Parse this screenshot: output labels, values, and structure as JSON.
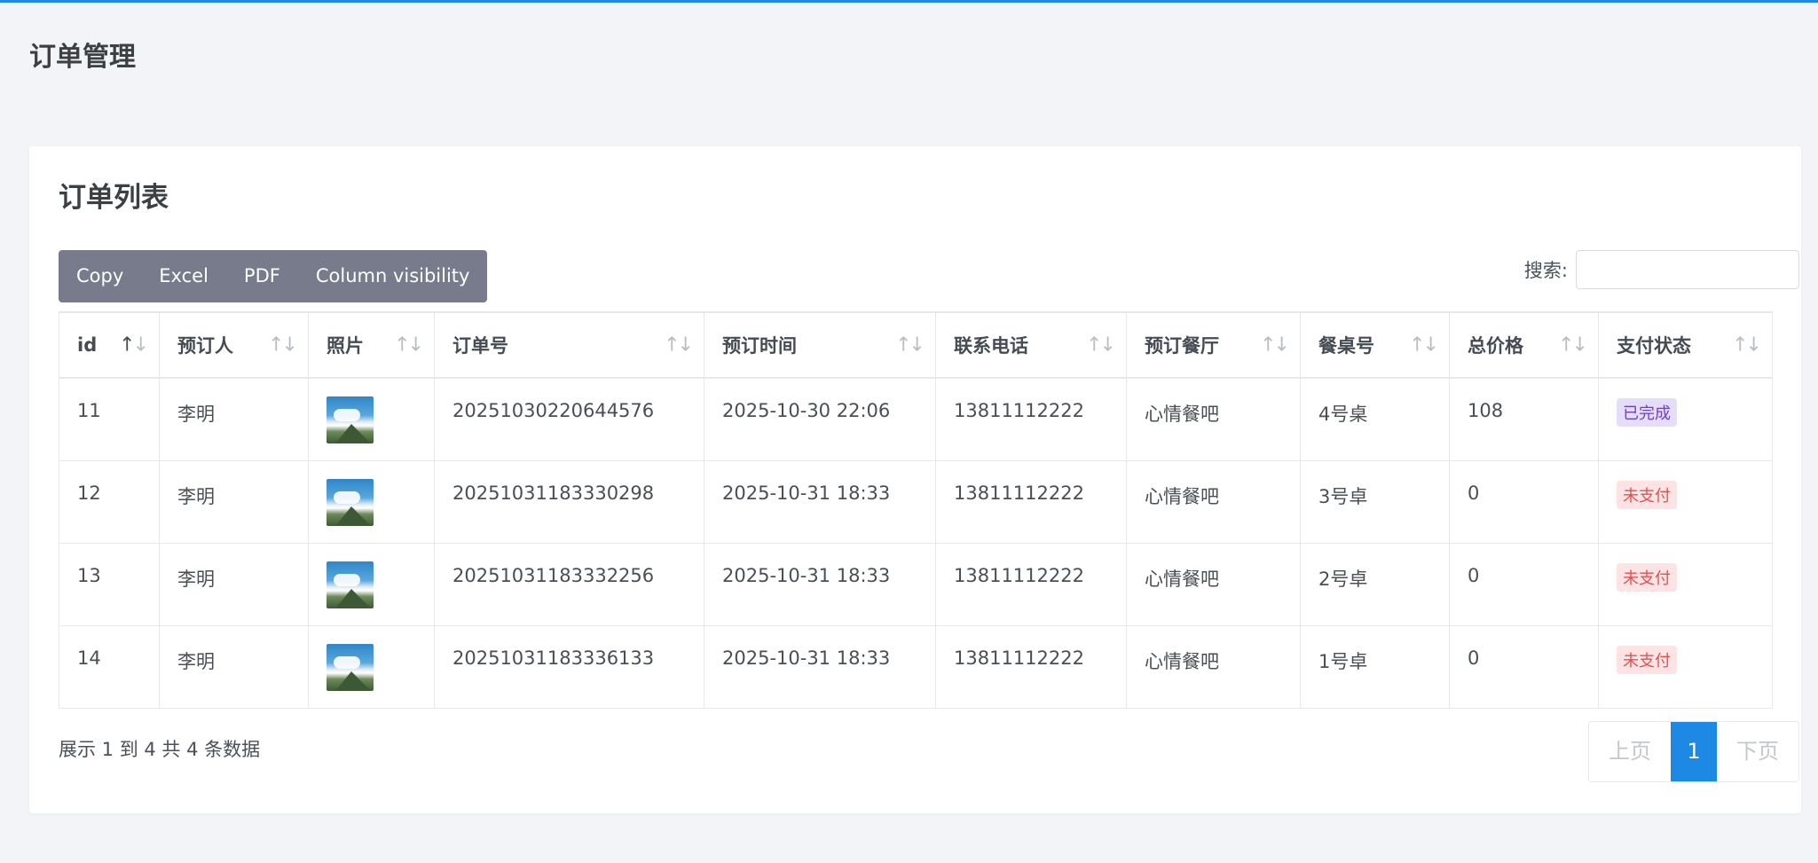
{
  "page": {
    "title": "订单管理"
  },
  "card": {
    "title": "订单列表"
  },
  "toolbar": {
    "buttons": [
      "Copy",
      "Excel",
      "PDF",
      "Column visibility"
    ]
  },
  "search": {
    "label": "搜索:",
    "value": ""
  },
  "table": {
    "columns": [
      "id",
      "预订人",
      "照片",
      "订单号",
      "预订时间",
      "联系电话",
      "预订餐厅",
      "餐桌号",
      "总价格",
      "支付状态"
    ],
    "sort": {
      "column": "id",
      "direction": "asc"
    },
    "rows": [
      {
        "id": "11",
        "name": "李明",
        "order_no": "20251030220644576",
        "time": "2025-10-30 22:06",
        "phone": "13811112222",
        "restaurant": "心情餐吧",
        "table_no": "4号桌",
        "total": "108",
        "status": "已完成",
        "status_type": "done"
      },
      {
        "id": "12",
        "name": "李明",
        "order_no": "20251031183330298",
        "time": "2025-10-31 18:33",
        "phone": "13811112222",
        "restaurant": "心情餐吧",
        "table_no": "3号卓",
        "total": "0",
        "status": "未支付",
        "status_type": "unpaid"
      },
      {
        "id": "13",
        "name": "李明",
        "order_no": "20251031183332256",
        "time": "2025-10-31 18:33",
        "phone": "13811112222",
        "restaurant": "心情餐吧",
        "table_no": "2号卓",
        "total": "0",
        "status": "未支付",
        "status_type": "unpaid"
      },
      {
        "id": "14",
        "name": "李明",
        "order_no": "20251031183336133",
        "time": "2025-10-31 18:33",
        "phone": "13811112222",
        "restaurant": "心情餐吧",
        "table_no": "1号卓",
        "total": "0",
        "status": "未支付",
        "status_type": "unpaid"
      }
    ]
  },
  "footer": {
    "info": "展示 1 到 4 共 4 条数据"
  },
  "pagination": {
    "prev": "上页",
    "current": "1",
    "next": "下页"
  },
  "colors": {
    "accent": "#1e88e5",
    "toolbar": "#777b8b",
    "done_badge": "#6f42c1",
    "unpaid_badge": "#e05252"
  }
}
